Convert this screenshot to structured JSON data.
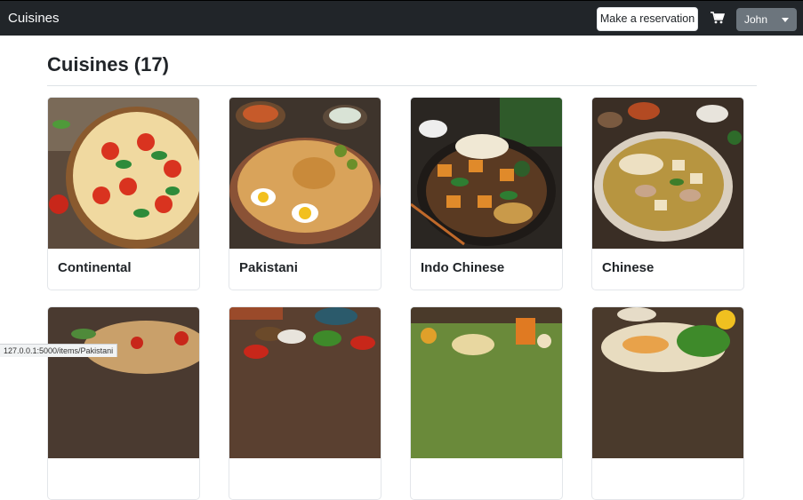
{
  "navbar": {
    "brand": "Cuisines",
    "reserve_label": "Make a reservation",
    "cart_icon": "shopping-cart-icon",
    "user_label": "John"
  },
  "page": {
    "title": "Cuisines (17)"
  },
  "cards": [
    {
      "name": "Continental"
    },
    {
      "name": "Pakistani"
    },
    {
      "name": "Indo Chinese"
    },
    {
      "name": "Chinese"
    },
    {
      "name": ""
    },
    {
      "name": ""
    },
    {
      "name": ""
    },
    {
      "name": ""
    }
  ],
  "status_bar": {
    "url": "127.0.0.1:5000/items/Pakistani"
  },
  "colors": {
    "navbar_bg": "#212529",
    "user_button_bg": "#6c757d",
    "card_border": "#e3e6ea"
  }
}
